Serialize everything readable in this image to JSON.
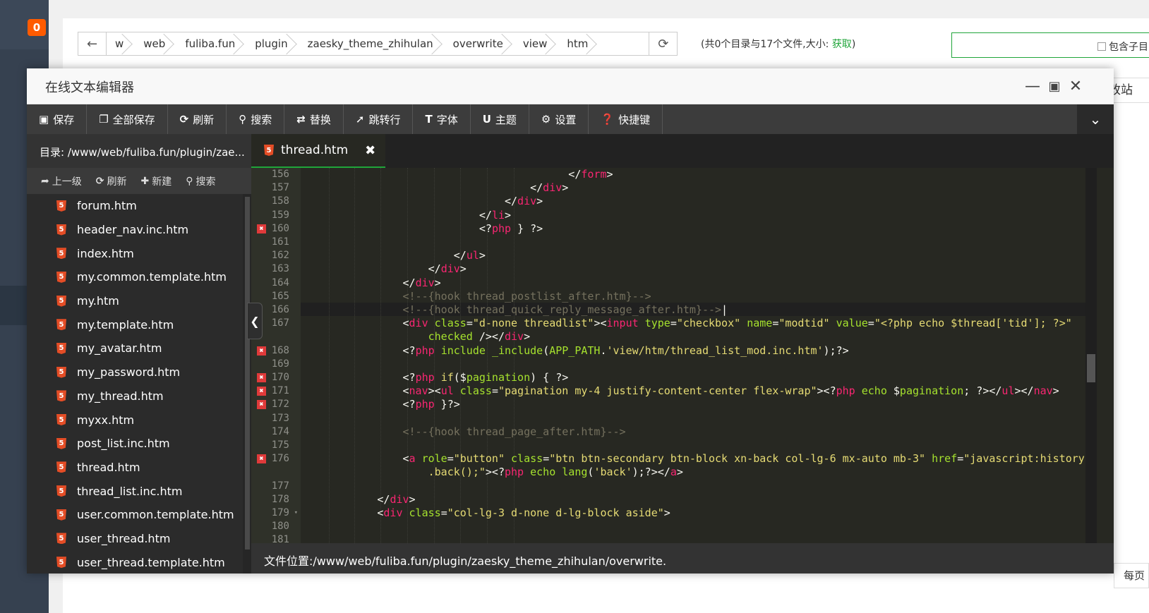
{
  "background": {
    "badge": "0",
    "breadcrumb": [
      "w",
      "web",
      "fuliba.fun",
      "plugin",
      "zaesky_theme_zhihulan",
      "overwrite",
      "view",
      "htm"
    ],
    "info_prefix": "(共0个目录与17个文件,大小: ",
    "info_link": "获取",
    "info_suffix": ")",
    "subdir_checkbox_label": "包含子目",
    "side_button": "改站",
    "pager_label": "每页"
  },
  "editor": {
    "title": "在线文本编辑器",
    "toolbar": {
      "save": "保存",
      "save_all": "全部保存",
      "refresh": "刷新",
      "search": "搜索",
      "replace": "替换",
      "goto_line": "跳转行",
      "font": "字体",
      "theme": "主题",
      "settings": "设置",
      "shortcuts": "快捷键"
    },
    "directory": "目录: /www/web/fuliba.fun/plugin/zae...",
    "tab": "thread.htm",
    "side_tools": {
      "up": "上一级",
      "refresh": "刷新",
      "new": "新建",
      "search": "搜索"
    },
    "files": [
      "forum.htm",
      "header_nav.inc.htm",
      "index.htm",
      "my.common.template.htm",
      "my.htm",
      "my.template.htm",
      "my_avatar.htm",
      "my_password.htm",
      "my_thread.htm",
      "myxx.htm",
      "post_list.inc.htm",
      "thread.htm",
      "thread_list.inc.htm",
      "user.common.template.htm",
      "user_thread.htm",
      "user_thread.template.htm"
    ],
    "status_label": "文件位置:",
    "status_path": "/www/web/fuliba.fun/plugin/zaesky_theme_zhihulan/overwrite.",
    "code_lines": [
      {
        "n": "156",
        "err": false
      },
      {
        "n": "157",
        "err": false
      },
      {
        "n": "158",
        "err": false
      },
      {
        "n": "159",
        "err": false
      },
      {
        "n": "160",
        "err": true
      },
      {
        "n": "161",
        "err": false
      },
      {
        "n": "162",
        "err": false
      },
      {
        "n": "163",
        "err": false
      },
      {
        "n": "164",
        "err": false
      },
      {
        "n": "165",
        "err": false
      },
      {
        "n": "166",
        "err": false
      },
      {
        "n": "167",
        "err": false
      },
      {
        "n": "",
        "err": false
      },
      {
        "n": "168",
        "err": true
      },
      {
        "n": "169",
        "err": false
      },
      {
        "n": "170",
        "err": true
      },
      {
        "n": "171",
        "err": true
      },
      {
        "n": "172",
        "err": true
      },
      {
        "n": "173",
        "err": false
      },
      {
        "n": "174",
        "err": false
      },
      {
        "n": "175",
        "err": false
      },
      {
        "n": "176",
        "err": true
      },
      {
        "n": "",
        "err": false
      },
      {
        "n": "177",
        "err": false
      },
      {
        "n": "178",
        "err": false
      },
      {
        "n": "179",
        "err": false
      },
      {
        "n": "180",
        "err": false
      },
      {
        "n": "181",
        "err": false
      }
    ]
  }
}
